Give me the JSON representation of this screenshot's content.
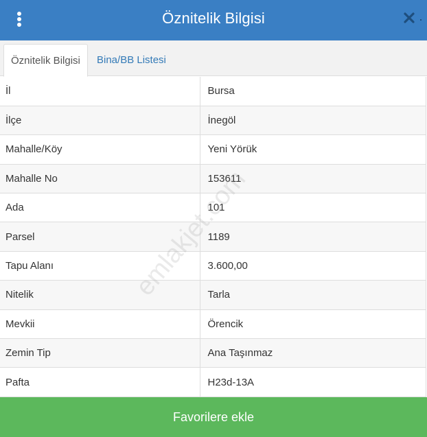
{
  "header": {
    "title": "Öznitelik Bilgisi"
  },
  "tabs": [
    {
      "label": "Öznitelik Bilgisi",
      "active": true
    },
    {
      "label": "Bina/BB Listesi",
      "active": false
    }
  ],
  "attributes": [
    {
      "key": "İl",
      "value": "Bursa"
    },
    {
      "key": "İlçe",
      "value": "İnegöl"
    },
    {
      "key": "Mahalle/Köy",
      "value": "Yeni Yörük"
    },
    {
      "key": "Mahalle No",
      "value": "153611"
    },
    {
      "key": "Ada",
      "value": "101"
    },
    {
      "key": "Parsel",
      "value": "1189"
    },
    {
      "key": "Tapu Alanı",
      "value": "3.600,00"
    },
    {
      "key": "Nitelik",
      "value": "Tarla"
    },
    {
      "key": "Mevkii",
      "value": "Örencik"
    },
    {
      "key": "Zemin Tip",
      "value": "Ana Taşınmaz"
    },
    {
      "key": "Pafta",
      "value": "H23d-13A"
    }
  ],
  "watermark": "emlakjet.com",
  "footer": {
    "favorite_label": "Favorilere ekle"
  },
  "colors": {
    "header_bg": "#3a7fc4",
    "tab_link": "#337ab7",
    "button_bg": "#5cb85c"
  },
  "icons": {
    "menu": "vertical-ellipsis-icon",
    "close": "close-icon"
  }
}
